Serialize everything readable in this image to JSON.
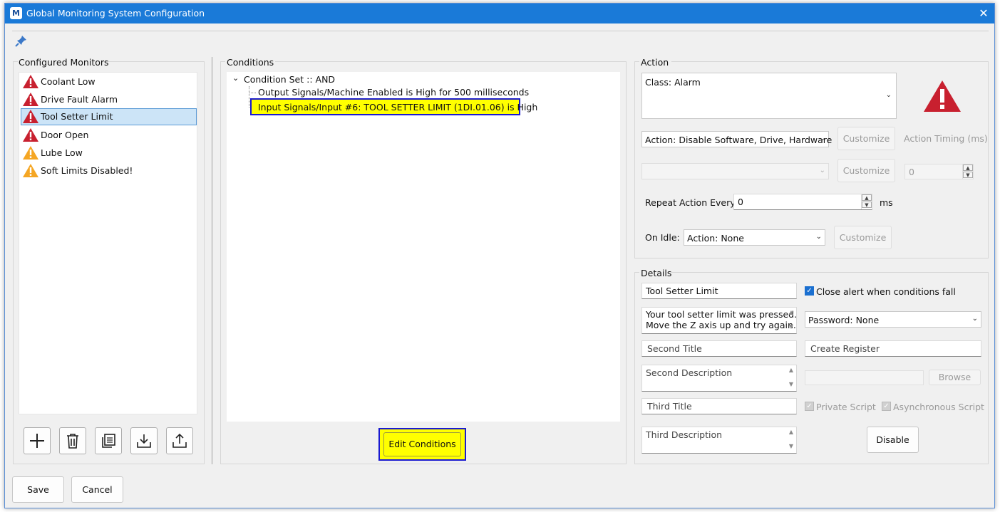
{
  "window": {
    "title": "Global Monitoring System Configuration",
    "app_icon": "M"
  },
  "monitors": {
    "label": "Configured Monitors",
    "items": [
      {
        "label": "Coolant Low",
        "icon": "alarm-red"
      },
      {
        "label": "Drive Fault Alarm",
        "icon": "alarm-red"
      },
      {
        "label": "Tool Setter Limit",
        "icon": "alarm-red",
        "selected": true
      },
      {
        "label": "Door Open",
        "icon": "alarm-red"
      },
      {
        "label": "Lube Low",
        "icon": "warning-orange"
      },
      {
        "label": "Soft Limits Disabled!",
        "icon": "warning-orange"
      }
    ]
  },
  "conditions": {
    "label": "Conditions",
    "root": "Condition Set :: AND",
    "children": [
      "Output Signals/Machine Enabled is High for 500 milliseconds",
      "Input Signals/Input #6: TOOL SETTER LIMIT (1DI.01.06) is High"
    ],
    "edit_button": "Edit Conditions"
  },
  "action": {
    "label": "Action",
    "class_text": "Class: Alarm",
    "action_select": "Action: Disable Software, Drive, Hardware",
    "customize_1": "Customize",
    "timing_label": "Action Timing (ms)",
    "action_select_2": "",
    "customize_2": "Customize",
    "timing_value": "0",
    "repeat_label": "Repeat Action Every",
    "repeat_value": "0",
    "repeat_unit": "ms",
    "on_idle_label": "On Idle:",
    "on_idle_select": "Action: None",
    "customize_3": "Customize"
  },
  "details": {
    "label": "Details",
    "title_value": "Tool Setter Limit",
    "close_alert_label": "Close alert when conditions fall",
    "close_alert_checked": true,
    "description_line1": "Your tool setter limit was pressed.",
    "description_line2": "Move the Z axis up and try again.",
    "password_select": "Password: None",
    "second_title_placeholder": "Second Title",
    "create_register_placeholder": "Create Register",
    "second_description_placeholder": "Second Description",
    "browse_label": "Browse",
    "third_title_placeholder": "Third Title",
    "private_script_label": "Private Script",
    "async_script_label": "Asynchronous Script",
    "third_description_placeholder": "Third Description",
    "disable_button": "Disable"
  },
  "footer": {
    "save": "Save",
    "cancel": "Cancel"
  },
  "colors": {
    "titlebar": "#1a7ad8",
    "highlight": "#ffff00",
    "highlight_border": "#1a1ad0",
    "alarm_red": "#c8202f",
    "warning_orange": "#f5a623"
  }
}
